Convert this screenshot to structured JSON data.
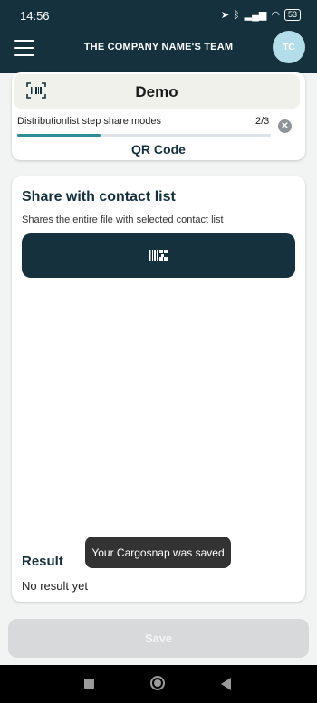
{
  "status_bar": {
    "time": "14:56",
    "battery": "53",
    "icons": [
      "navigation-icon",
      "bluetooth-icon",
      "signal-icon",
      "wifi-icon",
      "battery-icon"
    ]
  },
  "header": {
    "title": "THE COMPANY NAME'S TEAM",
    "avatar_initials": "TC",
    "menu_icon": "hamburger-menu-icon"
  },
  "demo_card": {
    "title": "Demo",
    "scan_icon": "qr-scan-icon",
    "step_label": "Distributionlist step share modes",
    "step_count": "2/3",
    "progress": 0.33,
    "mode_label": "QR Code"
  },
  "share_card": {
    "title": "Share with contact list",
    "description": "Shares the entire file with selected contact list",
    "button_icon": "qr-code-icon",
    "result_title": "Result",
    "result_text": "No result yet"
  },
  "toast": {
    "message": "Your Cargosnap was saved"
  },
  "footer": {
    "save_label": "Save"
  },
  "colors": {
    "primary": "#14313d",
    "accent": "#2e8d99",
    "avatar": "#b3dde8",
    "disabled": "#d7d9da"
  }
}
